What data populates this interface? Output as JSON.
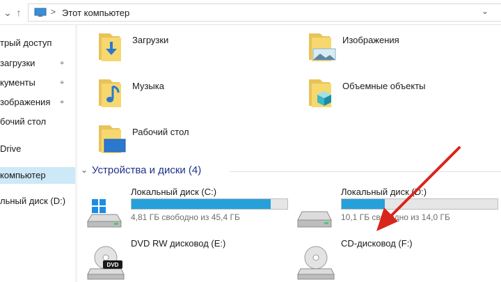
{
  "address": {
    "path": "Этот компьютер",
    "separator": ">"
  },
  "nav": {
    "items": [
      {
        "label": "трый доступ",
        "pinned": false
      },
      {
        "label": "загрузки",
        "pinned": true
      },
      {
        "label": "кументы",
        "pinned": true
      },
      {
        "label": "зображения",
        "pinned": true
      },
      {
        "label": "бочий стол",
        "pinned": false
      },
      {
        "label": "Drive",
        "pinned": false
      },
      {
        "label": "компьютер",
        "pinned": false,
        "selected": true
      },
      {
        "label": "льный диск (D:)",
        "pinned": false
      }
    ]
  },
  "folders": [
    {
      "name": "Загрузки",
      "icon": "downloads-folder-icon"
    },
    {
      "name": "Изображения",
      "icon": "pictures-folder-icon"
    },
    {
      "name": "Музыка",
      "icon": "music-folder-icon"
    },
    {
      "name": "Объемные объекты",
      "icon": "3d-objects-folder-icon"
    },
    {
      "name": "Рабочий стол",
      "icon": "desktop-folder-icon"
    }
  ],
  "devices_group": {
    "title": "Устройства и диски (4)"
  },
  "drives": [
    {
      "name": "Локальный диск (C:)",
      "free": "4,81 ГБ свободно из 45,4 ГБ",
      "used_fraction": 0.894,
      "icon": "windows-drive-icon"
    },
    {
      "name": "Локальный диск (D:)",
      "free": "10,1 ГБ свободно из 14,0 ГБ",
      "used_fraction": 0.279,
      "icon": "hard-drive-icon"
    },
    {
      "name": "DVD RW дисковод (E:)",
      "icon": "dvd-drive-icon"
    },
    {
      "name": "CD-дисковод (F:)",
      "icon": "cd-drive-icon"
    }
  ],
  "colors": {
    "accent": "#26a0da",
    "group_title": "#1e3287",
    "annotation_arrow": "#d9261c",
    "selected_nav": "#cde8f7"
  }
}
